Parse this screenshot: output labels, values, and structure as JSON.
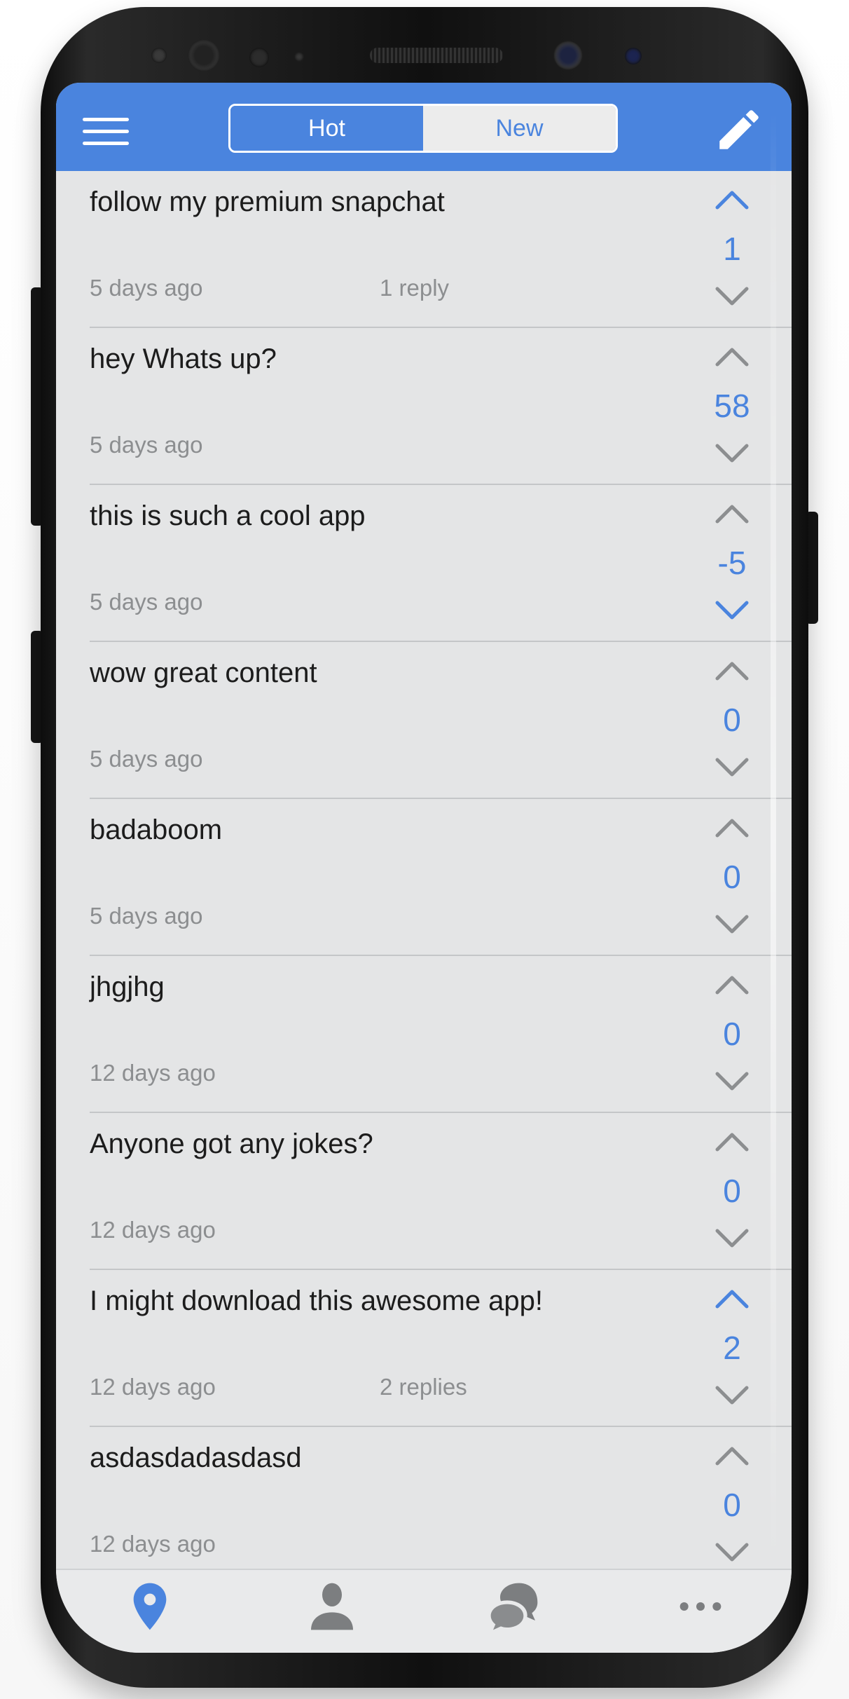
{
  "colors": {
    "accent": "#4a84de",
    "background": "#e4e5e6",
    "text": "#1c1c1c",
    "muted": "#8c8e90",
    "vote_neutral": "#8c8e90"
  },
  "header": {
    "menu_icon": "hamburger-menu-icon",
    "tabs": [
      {
        "label": "Hot",
        "active": true
      },
      {
        "label": "New",
        "active": false
      }
    ],
    "compose_icon": "pencil-icon"
  },
  "posts": [
    {
      "text": "follow my premium snapchat",
      "time": "5 days ago",
      "replies": "1 reply",
      "score": "1",
      "vote": "up"
    },
    {
      "text": "hey Whats up?",
      "time": "5 days ago",
      "replies": "",
      "score": "58",
      "vote": "none"
    },
    {
      "text": "this is such a cool app",
      "time": "5 days ago",
      "replies": "",
      "score": "-5",
      "vote": "down"
    },
    {
      "text": "wow great content",
      "time": "5 days ago",
      "replies": "",
      "score": "0",
      "vote": "none"
    },
    {
      "text": "badaboom",
      "time": "5 days ago",
      "replies": "",
      "score": "0",
      "vote": "none"
    },
    {
      "text": "jhgjhg",
      "time": "12 days ago",
      "replies": "",
      "score": "0",
      "vote": "none"
    },
    {
      "text": "Anyone got any jokes?",
      "time": "12 days ago",
      "replies": "",
      "score": "0",
      "vote": "none"
    },
    {
      "text": "I might download this awesome app!",
      "time": "12 days ago",
      "replies": "2 replies",
      "score": "2",
      "vote": "up"
    },
    {
      "text": "asdasdadasdasd",
      "time": "12 days ago",
      "replies": "",
      "score": "0",
      "vote": "none"
    }
  ],
  "bottom_nav": [
    {
      "icon": "location-pin-icon",
      "active": true
    },
    {
      "icon": "profile-icon",
      "active": false
    },
    {
      "icon": "chat-bubbles-icon",
      "active": false
    },
    {
      "icon": "more-dots-icon",
      "active": false
    }
  ]
}
